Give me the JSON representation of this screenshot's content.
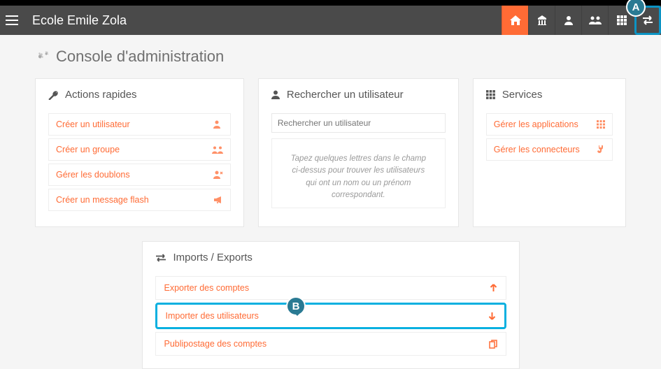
{
  "header": {
    "school_name": "Ecole Emile Zola"
  },
  "nav_icons": {
    "home": "home-icon",
    "school": "school-icon",
    "user": "user-icon",
    "group": "group-icon",
    "grid": "grid-icon",
    "transfer": "transfer-icon"
  },
  "callouts": {
    "a": "A",
    "b": "B"
  },
  "page": {
    "title": "Console d'administration"
  },
  "quick_actions": {
    "title": "Actions rapides",
    "items": [
      {
        "label": "Créer un utilisateur",
        "icon": "user-plus-icon"
      },
      {
        "label": "Créer un groupe",
        "icon": "group-icon"
      },
      {
        "label": "Gérer les doublons",
        "icon": "user-x-icon"
      },
      {
        "label": "Créer un message flash",
        "icon": "bullhorn-icon"
      }
    ]
  },
  "user_search": {
    "title": "Rechercher un utilisateur",
    "placeholder": "Rechercher un utilisateur",
    "hint": "Tapez quelques lettres dans le champ ci-dessus pour trouver les utilisateurs qui ont un nom ou un prénom correspondant."
  },
  "services": {
    "title": "Services",
    "items": [
      {
        "label": "Gérer les applications",
        "icon": "grid-icon"
      },
      {
        "label": "Gérer les connecteurs",
        "icon": "plug-icon"
      }
    ]
  },
  "imports_exports": {
    "title": "Imports / Exports",
    "items": [
      {
        "label": "Exporter des comptes",
        "icon": "arrow-up-icon"
      },
      {
        "label": "Importer des utilisateurs",
        "icon": "arrow-down-icon",
        "highlighted": true
      },
      {
        "label": "Publipostage des comptes",
        "icon": "copy-icon"
      }
    ]
  }
}
